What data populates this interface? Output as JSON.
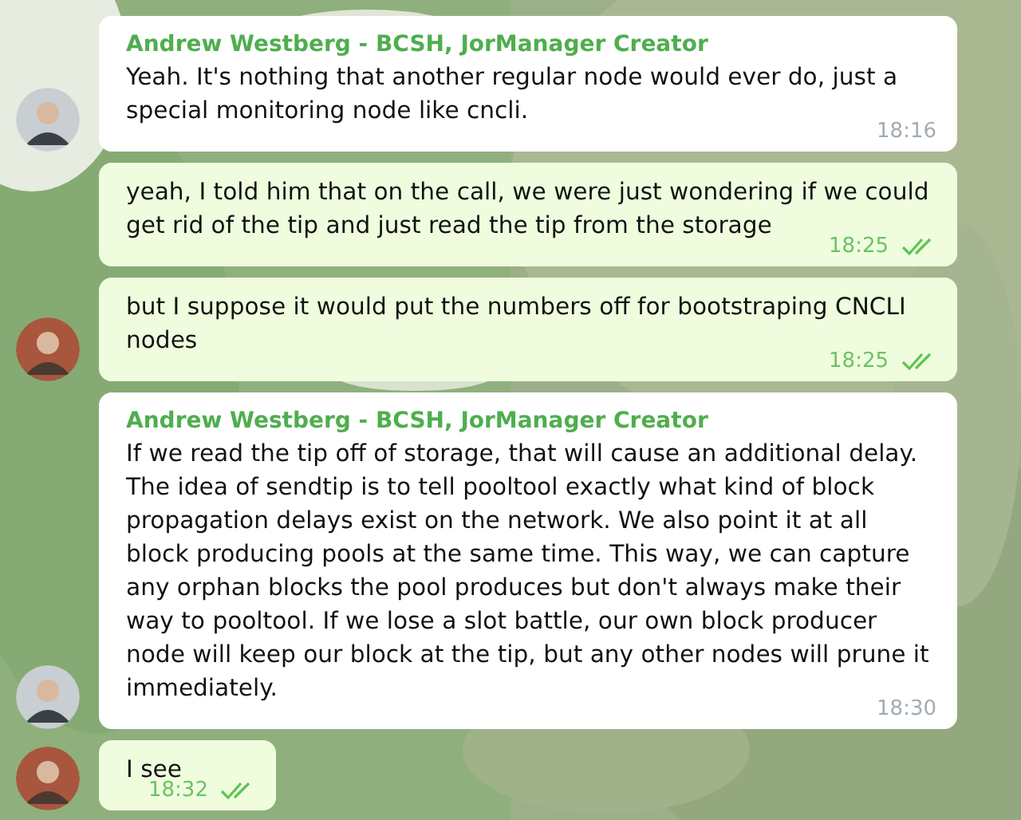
{
  "messages": [
    {
      "kind": "incoming",
      "sender": "Andrew Westberg - BCSH, JorManager Creator",
      "text": "Yeah. It's nothing that another regular node would ever do, just a special monitoring node like cncli.",
      "time": "18:16",
      "avatar": true
    },
    {
      "kind": "outgoing",
      "text": "yeah, I told him that on the call, we were just wondering if we could get rid of the tip and just read the tip from the storage",
      "time": "18:25",
      "read": true,
      "avatar": false
    },
    {
      "kind": "outgoing",
      "text": "but I suppose it would put the numbers off for bootstraping CNCLI nodes",
      "time": "18:25",
      "read": true,
      "avatar": true
    },
    {
      "kind": "incoming",
      "sender": "Andrew Westberg - BCSH, JorManager Creator",
      "text": "If we read the tip off of storage, that will cause an additional delay. The idea of sendtip is to tell pooltool exactly what kind of block propagation delays exist on the network. We also point it at all block producing pools at the same time. This way, we can capture any orphan blocks the pool produces but don't always make their way to pooltool. If we lose a slot battle, our own block producer node will keep our block at the tip, but any other nodes will prune it immediately.",
      "time": "18:30",
      "avatar": true
    },
    {
      "kind": "outgoing",
      "text": "I see",
      "time": "18:32",
      "read": true,
      "avatar": true
    }
  ]
}
